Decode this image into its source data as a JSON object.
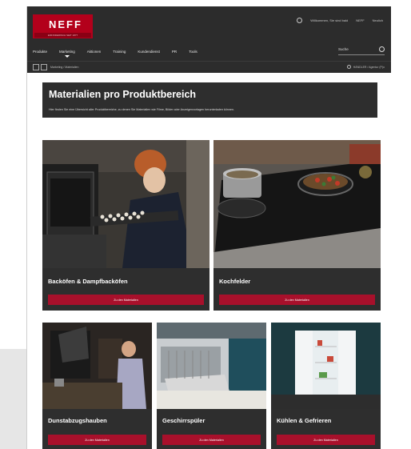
{
  "header": {
    "logo_text": "NEFF",
    "logo_sub": "ERFINDERISCH SEIT 1877",
    "welcome": "Willkommen, Sie sind bald",
    "account": "NEFF",
    "help": "Neulich",
    "nav": [
      "Produkte",
      "Marketing",
      "Aktionen",
      "Training",
      "Kundendienst",
      "PR",
      "Tools"
    ],
    "active_nav": "Marketing",
    "search_label": "Suche",
    "breadcrumb": "Marketing / Materialien",
    "portal_label": "HÄNDLER / Agentur (P)o"
  },
  "page": {
    "title": "Materialien pro Produktbereich",
    "intro": "Hier finden Sie eine Übersicht aller Produktbereiche, zu denen Sie Materialien wie Filme, Bilder oder Anzeigenvorlagen herunterladen können."
  },
  "cards": [
    {
      "title": "Backöfen & Dampfbacköfen",
      "button": "Zu den Materialien"
    },
    {
      "title": "Kochfelder",
      "button": "Zu den Materialien"
    },
    {
      "title": "Dunstabzugshauben",
      "button": "Zu den Materialien"
    },
    {
      "title": "Geschirrspüler",
      "button": "Zu den Materialien"
    },
    {
      "title": "Kühlen & Gefrieren",
      "button": "Zu den Materialien"
    }
  ],
  "colors": {
    "brand_red": "#b3001b",
    "button_red": "#a8102b",
    "dark": "#2e2e2e"
  }
}
